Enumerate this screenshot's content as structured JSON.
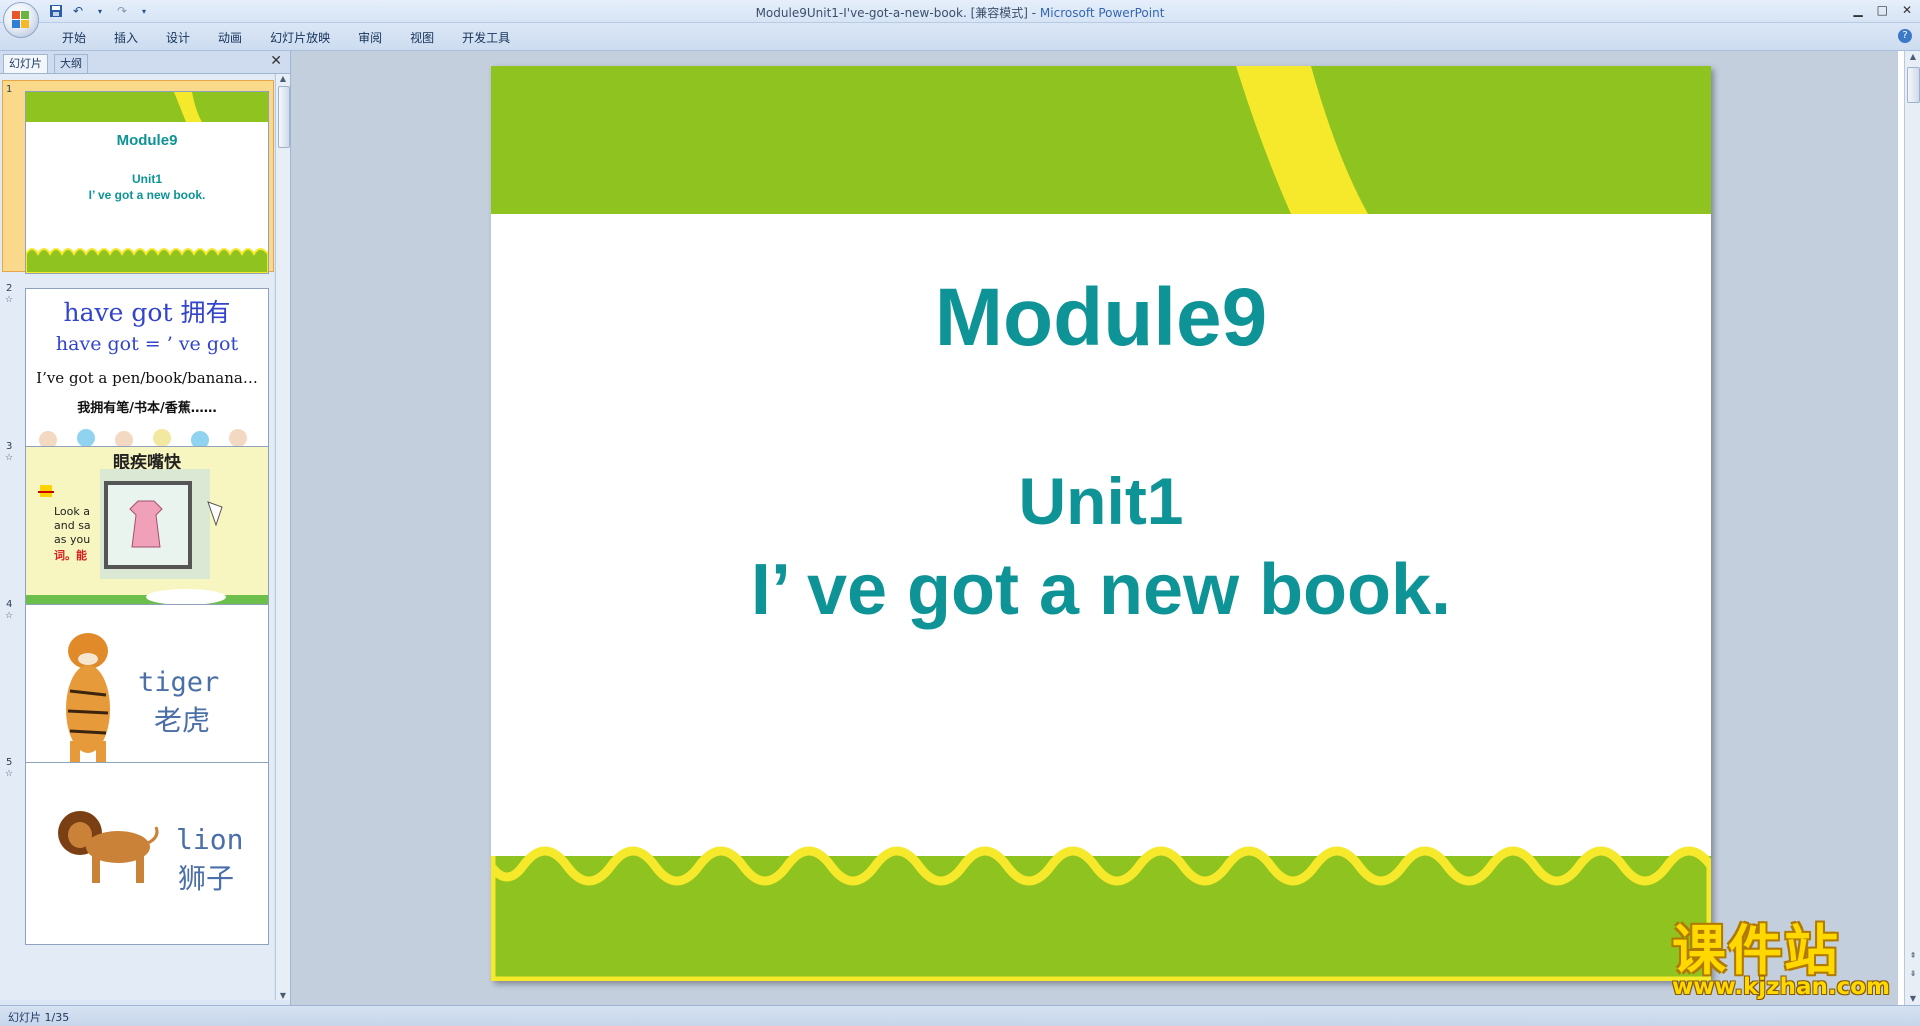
{
  "window": {
    "doc_title": "Module9Unit1-I've-got-a-new-book. [兼容模式]",
    "separator": " - ",
    "app_name": "Microsoft PowerPoint"
  },
  "ribbon": {
    "tabs": [
      "开始",
      "插入",
      "设计",
      "动画",
      "幻灯片放映",
      "审阅",
      "视图",
      "开发工具"
    ],
    "help_label": "?"
  },
  "pane": {
    "tab_slides": "幻灯片",
    "tab_outline": "大纲",
    "close_label": "✕"
  },
  "thumbnails": [
    {
      "num": "1",
      "title": "Module9",
      "line1": "Unit1",
      "line2": "I’ ve got a new book."
    },
    {
      "num": "2",
      "line1": "have got 拥有",
      "line2": "have got = ’ ve got",
      "line3": "I’ve got a pen/book/banana…",
      "line4": "我拥有笔/书本/香蕉……"
    },
    {
      "num": "3",
      "line1": "眼疾嘴快",
      "line2": "Look a",
      "line3": "and sa",
      "line4": "as you",
      "line5": "词。能"
    },
    {
      "num": "4",
      "word": "tiger",
      "cn": "老虎"
    },
    {
      "num": "5",
      "word": "lion",
      "cn": "狮子"
    }
  ],
  "slide": {
    "title": "Module9",
    "subtitle1": "Unit1",
    "subtitle2": "I’ ve got a new book."
  },
  "status": {
    "text": "幻灯片 1/35"
  },
  "watermark": {
    "big": "课件站",
    "small": "www.kjzhan.com"
  },
  "colors": {
    "green": "#8fc31f",
    "yellow": "#f6e82a",
    "teal": "#0e9396"
  }
}
